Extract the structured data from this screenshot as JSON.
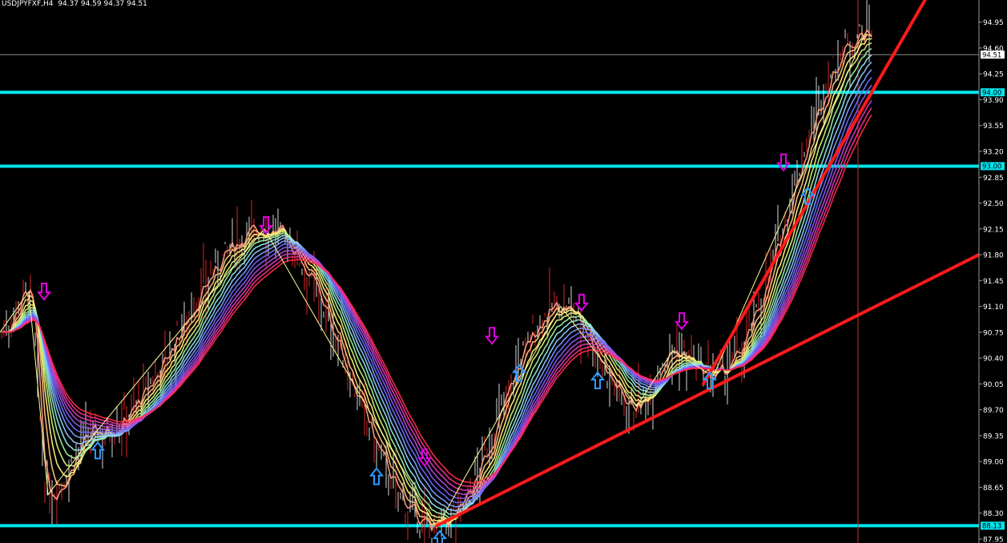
{
  "header": {
    "symbol": "USDJPYFXF,H4",
    "ohlc": "94.37 94.59 94.37 94.51"
  },
  "chart_data": {
    "type": "line",
    "ylim": [
      87.95,
      95.12
    ],
    "y_ticks": [
      "94.95",
      "94.60",
      "94.25",
      "93.90",
      "93.55",
      "93.20",
      "92.85",
      "92.50",
      "92.15",
      "91.80",
      "91.45",
      "91.10",
      "90.75",
      "90.40",
      "90.05",
      "89.70",
      "89.35",
      "89.00",
      "88.65",
      "88.30",
      "87.95"
    ],
    "grid": false,
    "current_price": {
      "value": 94.51,
      "label": "94.51"
    },
    "horizontal_levels": [
      {
        "value": 94.0,
        "label": "94.00",
        "color": "#00e5ee"
      },
      {
        "value": 93.0,
        "label": "93.00",
        "color": "#00e5ee"
      },
      {
        "value": 88.13,
        "label": "88.13",
        "color": "#00e5ee"
      }
    ],
    "colors": {
      "background": "#000000",
      "level_line": "#00e5ee",
      "trend_line": "#ff1a1a",
      "zigzag": "#ffff99",
      "up_arrow": "#3399ff",
      "down_arrow": "#e100e1",
      "bar": "#ffffff",
      "bear_bar": "#ff3030",
      "cursor_line": "#c0392b"
    },
    "zigzag": [
      [
        0,
        90.75
      ],
      [
        36,
        91.3
      ],
      [
        60,
        88.55
      ],
      [
        120,
        89.4
      ],
      [
        330,
        92.15
      ],
      [
        545,
        88.1
      ],
      [
        700,
        91.1
      ],
      [
        795,
        89.75
      ],
      [
        840,
        90.5
      ],
      [
        890,
        90.15
      ],
      [
        1080,
        94.8
      ]
    ],
    "up_arrows": [
      [
        122,
        89.3
      ],
      [
        470,
        88.95
      ],
      [
        549,
        88.1
      ],
      [
        648,
        90.35
      ],
      [
        746,
        90.25
      ],
      [
        886,
        90.25
      ],
      [
        1008,
        92.75
      ]
    ],
    "down_arrows": [
      [
        55,
        91.15
      ],
      [
        332,
        92.05
      ],
      [
        530,
        88.9
      ],
      [
        614,
        90.55
      ],
      [
        726,
        91.0
      ],
      [
        851,
        90.75
      ],
      [
        978,
        92.9
      ]
    ],
    "trend_lines": [
      {
        "from": [
          545,
          88.13
        ],
        "to": [
          1222,
          91.8
        ]
      },
      {
        "from": [
          878,
          90.05
        ],
        "to": [
          1160,
          95.35
        ]
      }
    ],
    "ma_ribbon_colors": [
      "#ff9e80",
      "#ffc27a",
      "#fff27a",
      "#d6f07a",
      "#9ef09e",
      "#8ce6e6",
      "#8cc6ff",
      "#7a9cff",
      "#6a6aff",
      "#8a5af0",
      "#b04ad6",
      "#d83ab8",
      "#f0308a",
      "#ff2a4a"
    ]
  }
}
